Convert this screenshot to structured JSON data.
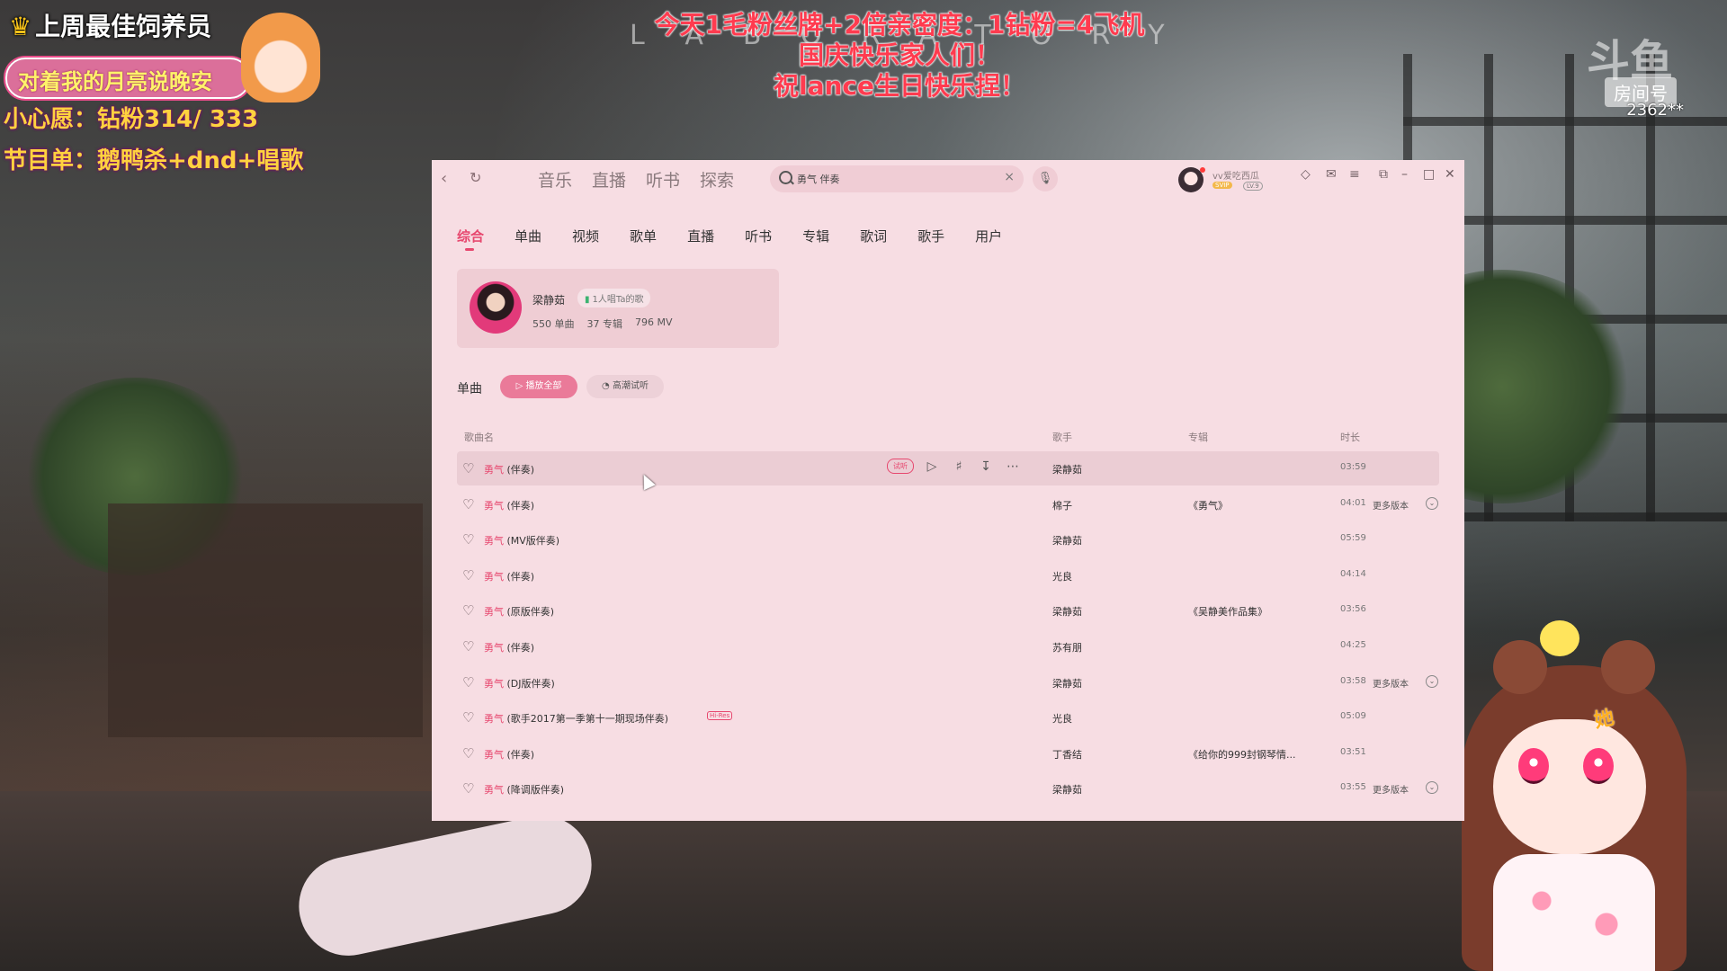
{
  "stream": {
    "top_left_title": "上周最佳饲养员",
    "top_left_pill": "对着我的月亮说晚安",
    "wish_line": "小心愿：钻粉314/ 333",
    "program_line": "节目单：鹅鸭杀+dnd+唱歌",
    "announcement_lines": [
      "今天1毛粉丝牌+2倍亲密度：1钻粉=4飞机",
      "国庆快乐家人们！",
      "祝lance生日快乐捏！"
    ],
    "platform_logo": "斗鱼",
    "room_label": "房间号",
    "room_number": "2362**",
    "vtuber_tag": "她",
    "background_brand": "LABORATORY"
  },
  "app": {
    "nav_back_icon": "chevron-left-icon",
    "nav_refresh_icon": "refresh-icon",
    "top_nav": [
      "音乐",
      "直播",
      "听书",
      "探索"
    ],
    "search": {
      "value": "勇气  伴奏"
    },
    "user": {
      "name": "vv爱吃西瓜",
      "badge": "SVIP",
      "level": "LV.9"
    },
    "tabs": [
      "综合",
      "单曲",
      "视频",
      "歌单",
      "直播",
      "听书",
      "专辑",
      "歌词",
      "歌手",
      "用户"
    ],
    "active_tab": "综合",
    "artist_card": {
      "name": "梁静茹",
      "badge": "1人唱Ta的歌",
      "stats": [
        "550 单曲",
        "37 专辑",
        "796 MV"
      ]
    },
    "single_section": {
      "label": "单曲",
      "play_all": "播放全部",
      "hq_listen": "高潮试听"
    },
    "table": {
      "headers": {
        "song": "歌曲名",
        "artist": "歌手",
        "album": "专辑",
        "duration": "时长"
      },
      "rows": [
        {
          "keyword": "勇气",
          "rest": " (伴奏)",
          "hires": "",
          "artist": "梁静茹",
          "album": "",
          "duration": "03:59",
          "more": ""
        },
        {
          "keyword": "勇气",
          "rest": " (伴奏)",
          "hires": "",
          "artist": "棉子",
          "album": "《勇气》",
          "duration": "04:01",
          "more": "更多版本"
        },
        {
          "keyword": "勇气",
          "rest": " (MV版伴奏)",
          "hires": "",
          "artist": "梁静茹",
          "album": "",
          "duration": "05:59",
          "more": ""
        },
        {
          "keyword": "勇气",
          "rest": " (伴奏)",
          "hires": "",
          "artist": "光良",
          "album": "",
          "duration": "04:14",
          "more": ""
        },
        {
          "keyword": "勇气",
          "rest": " (原版伴奏)",
          "hires": "",
          "artist": "梁静茹",
          "album": "《吴静美作品集》",
          "duration": "03:56",
          "more": ""
        },
        {
          "keyword": "勇气",
          "rest": " (伴奏)",
          "hires": "",
          "artist": "苏有朋",
          "album": "",
          "duration": "04:25",
          "more": ""
        },
        {
          "keyword": "勇气",
          "rest": " (DJ版伴奏)",
          "hires": "",
          "artist": "梁静茹",
          "album": "",
          "duration": "03:58",
          "more": "更多版本"
        },
        {
          "keyword": "勇气",
          "rest": " (歌手2017第一季第十一期现场伴奏)",
          "hires": "Hi-Res",
          "artist": "光良",
          "album": "",
          "duration": "05:09",
          "more": ""
        },
        {
          "keyword": "勇气",
          "rest": " (伴奏)",
          "hires": "",
          "artist": "丁香结",
          "album": "《给你的999封钢琴情...",
          "duration": "03:51",
          "more": ""
        },
        {
          "keyword": "勇气",
          "rest": " (降调版伴奏)",
          "hires": "",
          "artist": "梁静茹",
          "album": "",
          "duration": "03:55",
          "more": "更多版本"
        }
      ],
      "row_hover_try": "试听"
    }
  },
  "colors": {
    "accent": "#e7486f",
    "window_bg": "#f7dde3"
  }
}
